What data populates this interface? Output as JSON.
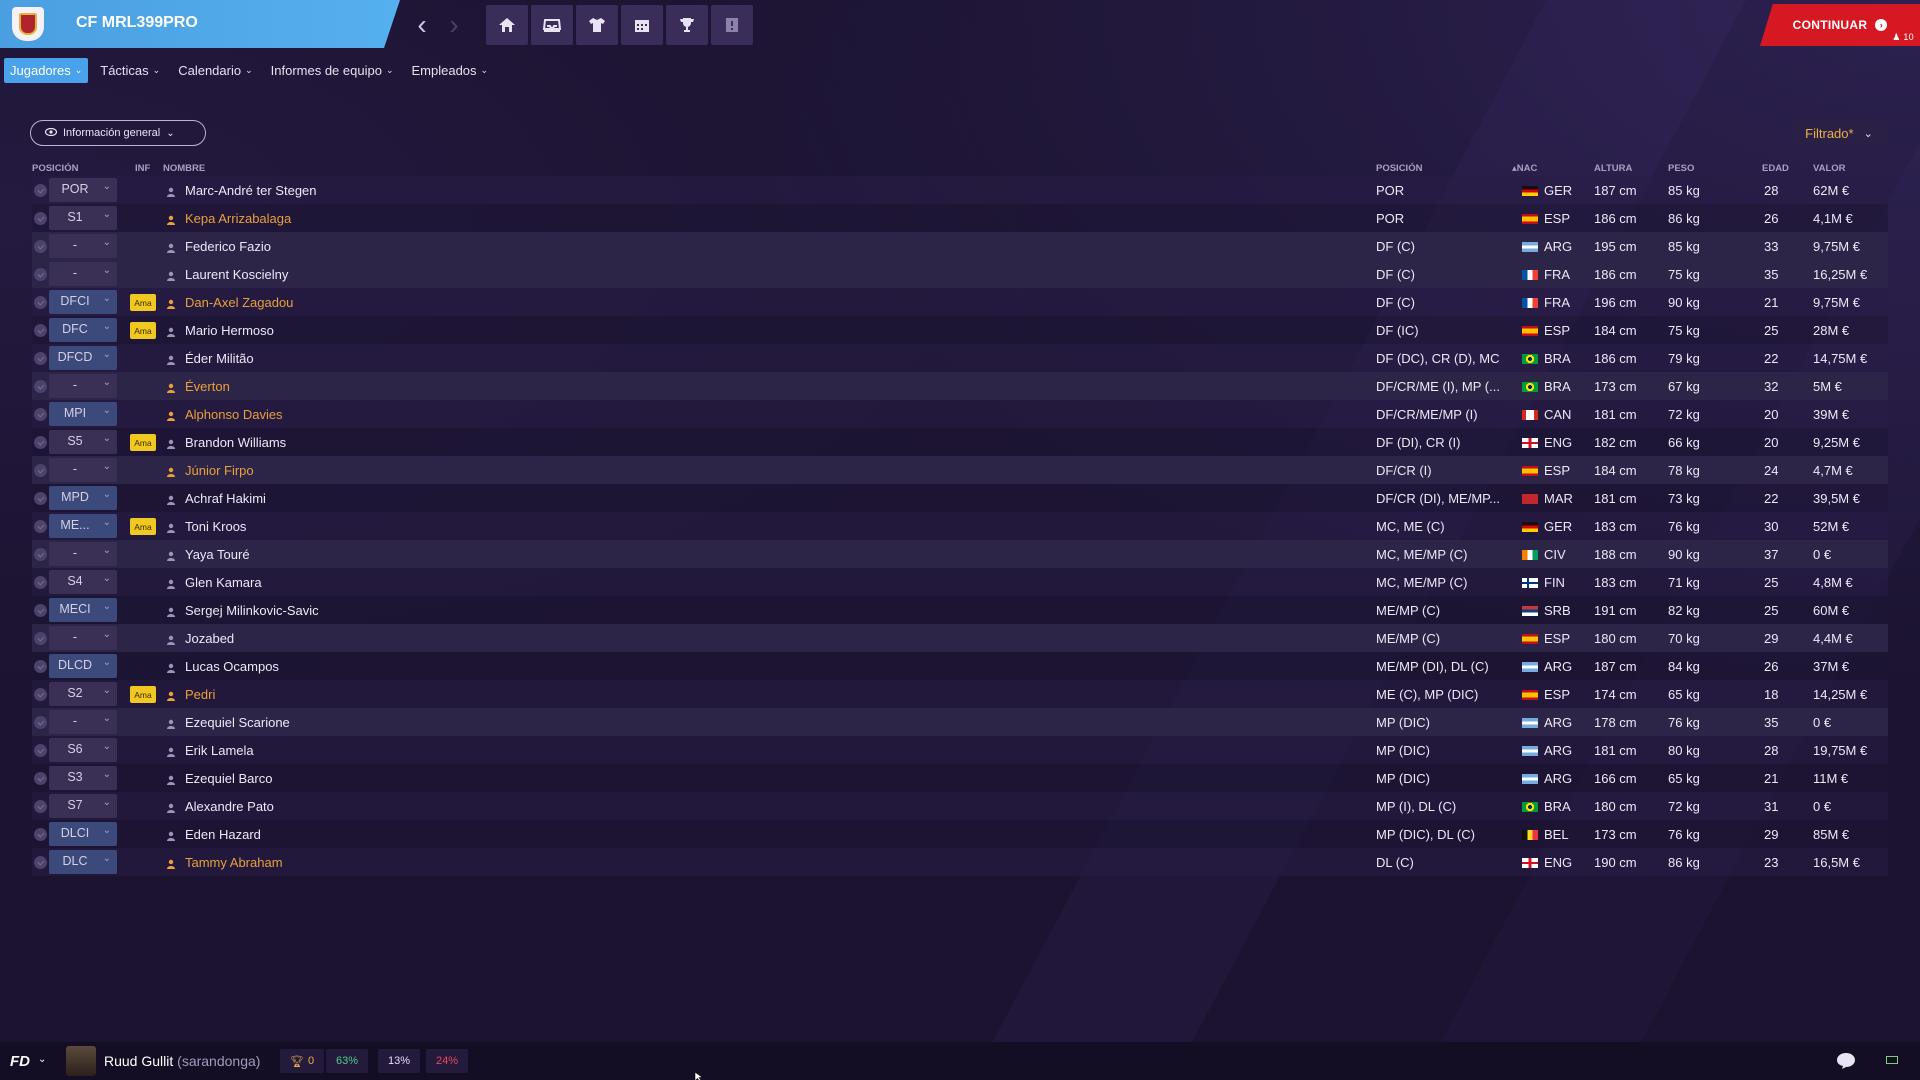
{
  "header": {
    "club_name": "CF MRL399PRO",
    "continue_label": "CONTINUAR",
    "continue_count": "10"
  },
  "menu": {
    "items": [
      {
        "label": "Jugadores"
      },
      {
        "label": "Tácticas"
      },
      {
        "label": "Calendario"
      },
      {
        "label": "Informes de equipo"
      },
      {
        "label": "Empleados"
      }
    ]
  },
  "view_select": {
    "label": "Información general"
  },
  "filter": {
    "label": "Filtrado*"
  },
  "columns": {
    "posicion_sel": "POSICIÓN",
    "inf": "INF",
    "nombre": "NOMBRE",
    "posicion": "POSICIÓN",
    "nac": "NAC",
    "altura": "ALTURA",
    "peso": "PESO",
    "edad": "EDAD",
    "valor": "VALOR"
  },
  "players": [
    {
      "sel": "POR",
      "ama": "",
      "name": "Marc-André ter Stegen",
      "orange": false,
      "position": "POR",
      "flag": "ger",
      "nat": "GER",
      "height": "187 cm",
      "weight": "85 kg",
      "age": "28",
      "value": "62M €"
    },
    {
      "sel": "S1",
      "ama": "",
      "name": "Kepa Arrizabalaga",
      "orange": true,
      "position": "POR",
      "flag": "esp",
      "nat": "ESP",
      "height": "186 cm",
      "weight": "86 kg",
      "age": "26",
      "value": "4,1M €"
    },
    {
      "sel": "-",
      "ama": "",
      "name": "Federico Fazio",
      "orange": false,
      "position": "DF (C)",
      "flag": "arg",
      "nat": "ARG",
      "height": "195 cm",
      "weight": "85 kg",
      "age": "33",
      "value": "9,75M €"
    },
    {
      "sel": "-",
      "ama": "",
      "name": "Laurent Koscielny",
      "orange": false,
      "position": "DF (C)",
      "flag": "fra",
      "nat": "FRA",
      "height": "186 cm",
      "weight": "75 kg",
      "age": "35",
      "value": "16,25M €"
    },
    {
      "sel": "DFCI",
      "ama": "Ama",
      "name": "Dan-Axel Zagadou",
      "orange": true,
      "position": "DF (C)",
      "flag": "fra",
      "nat": "FRA",
      "height": "196 cm",
      "weight": "90 kg",
      "age": "21",
      "value": "9,75M €"
    },
    {
      "sel": "DFC",
      "ama": "Ama",
      "name": "Mario Hermoso",
      "orange": false,
      "position": "DF (IC)",
      "flag": "esp",
      "nat": "ESP",
      "height": "184 cm",
      "weight": "75 kg",
      "age": "25",
      "value": "28M €"
    },
    {
      "sel": "DFCD",
      "ama": "",
      "name": "Éder Militão",
      "orange": false,
      "position": "DF (DC), CR (D), MC",
      "flag": "bra",
      "nat": "BRA",
      "height": "186 cm",
      "weight": "79 kg",
      "age": "22",
      "value": "14,75M €"
    },
    {
      "sel": "-",
      "ama": "",
      "name": "Éverton",
      "orange": true,
      "position": "DF/CR/ME (I), MP (...",
      "flag": "bra",
      "nat": "BRA",
      "height": "173 cm",
      "weight": "67 kg",
      "age": "32",
      "value": "5M €"
    },
    {
      "sel": "MPI",
      "ama": "",
      "name": "Alphonso Davies",
      "orange": true,
      "position": "DF/CR/ME/MP (I)",
      "flag": "can",
      "nat": "CAN",
      "height": "181 cm",
      "weight": "72 kg",
      "age": "20",
      "value": "39M €"
    },
    {
      "sel": "S5",
      "ama": "Ama",
      "name": "Brandon Williams",
      "orange": false,
      "position": "DF (DI), CR (I)",
      "flag": "eng",
      "nat": "ENG",
      "height": "182 cm",
      "weight": "66 kg",
      "age": "20",
      "value": "9,25M €"
    },
    {
      "sel": "-",
      "ama": "",
      "name": "Júnior Firpo",
      "orange": true,
      "position": "DF/CR (I)",
      "flag": "esp",
      "nat": "ESP",
      "height": "184 cm",
      "weight": "78 kg",
      "age": "24",
      "value": "4,7M €"
    },
    {
      "sel": "MPD",
      "ama": "",
      "name": "Achraf Hakimi",
      "orange": false,
      "position": "DF/CR (DI), ME/MP...",
      "flag": "mar",
      "nat": "MAR",
      "height": "181 cm",
      "weight": "73 kg",
      "age": "22",
      "value": "39,5M €"
    },
    {
      "sel": "ME...",
      "ama": "Ama",
      "name": "Toni Kroos",
      "orange": false,
      "position": "MC, ME (C)",
      "flag": "ger",
      "nat": "GER",
      "height": "183 cm",
      "weight": "76 kg",
      "age": "30",
      "value": "52M €"
    },
    {
      "sel": "-",
      "ama": "",
      "name": "Yaya Touré",
      "orange": false,
      "position": "MC, ME/MP (C)",
      "flag": "civ",
      "nat": "CIV",
      "height": "188 cm",
      "weight": "90 kg",
      "age": "37",
      "value": "0 €"
    },
    {
      "sel": "S4",
      "ama": "",
      "name": "Glen Kamara",
      "orange": false,
      "position": "MC, ME/MP (C)",
      "flag": "fin",
      "nat": "FIN",
      "height": "183 cm",
      "weight": "71 kg",
      "age": "25",
      "value": "4,8M €"
    },
    {
      "sel": "MECI",
      "ama": "",
      "name": "Sergej Milinkovic-Savic",
      "orange": false,
      "position": "ME/MP (C)",
      "flag": "srb",
      "nat": "SRB",
      "height": "191 cm",
      "weight": "82 kg",
      "age": "25",
      "value": "60M €"
    },
    {
      "sel": "-",
      "ama": "",
      "name": "Jozabed",
      "orange": false,
      "position": "ME/MP (C)",
      "flag": "esp",
      "nat": "ESP",
      "height": "180 cm",
      "weight": "70 kg",
      "age": "29",
      "value": "4,4M €"
    },
    {
      "sel": "DLCD",
      "ama": "",
      "name": "Lucas Ocampos",
      "orange": false,
      "position": "ME/MP (DI), DL (C)",
      "flag": "arg",
      "nat": "ARG",
      "height": "187 cm",
      "weight": "84 kg",
      "age": "26",
      "value": "37M €"
    },
    {
      "sel": "S2",
      "ama": "Ama",
      "name": "Pedri",
      "orange": true,
      "position": "ME (C), MP (DIC)",
      "flag": "esp",
      "nat": "ESP",
      "height": "174 cm",
      "weight": "65 kg",
      "age": "18",
      "value": "14,25M €"
    },
    {
      "sel": "-",
      "ama": "",
      "name": "Ezequiel Scarione",
      "orange": false,
      "position": "MP (DIC)",
      "flag": "arg",
      "nat": "ARG",
      "height": "178 cm",
      "weight": "76 kg",
      "age": "35",
      "value": "0 €"
    },
    {
      "sel": "S6",
      "ama": "",
      "name": "Erik Lamela",
      "orange": false,
      "position": "MP (DIC)",
      "flag": "arg",
      "nat": "ARG",
      "height": "181 cm",
      "weight": "80 kg",
      "age": "28",
      "value": "19,75M €"
    },
    {
      "sel": "S3",
      "ama": "",
      "name": "Ezequiel Barco",
      "orange": false,
      "position": "MP (DIC)",
      "flag": "arg",
      "nat": "ARG",
      "height": "166 cm",
      "weight": "65 kg",
      "age": "21",
      "value": "11M €"
    },
    {
      "sel": "S7",
      "ama": "",
      "name": "Alexandre Pato",
      "orange": false,
      "position": "MP (I), DL (C)",
      "flag": "bra",
      "nat": "BRA",
      "height": "180 cm",
      "weight": "72 kg",
      "age": "31",
      "value": "0 €"
    },
    {
      "sel": "DLCI",
      "ama": "",
      "name": "Eden Hazard",
      "orange": false,
      "position": "MP (DIC), DL (C)",
      "flag": "bel",
      "nat": "BEL",
      "height": "173 cm",
      "weight": "76 kg",
      "age": "29",
      "value": "85M €"
    },
    {
      "sel": "DLC",
      "ama": "",
      "name": "Tammy Abraham",
      "orange": true,
      "position": "DL (C)",
      "flag": "eng",
      "nat": "ENG",
      "height": "190 cm",
      "weight": "86 kg",
      "age": "23",
      "value": "16,5M €"
    }
  ],
  "footer": {
    "manager_name": "Ruud Gullit",
    "manager_nick": "(sarandonga)",
    "trophies": "0",
    "stat_green": "63%",
    "stat_white": "13%",
    "stat_red": "24%"
  },
  "colors": {
    "accent_blue": "#4aa3ea",
    "continue_red": "#d61822",
    "orange_name": "#e8a03c",
    "ama_yellow": "#f1c722"
  }
}
